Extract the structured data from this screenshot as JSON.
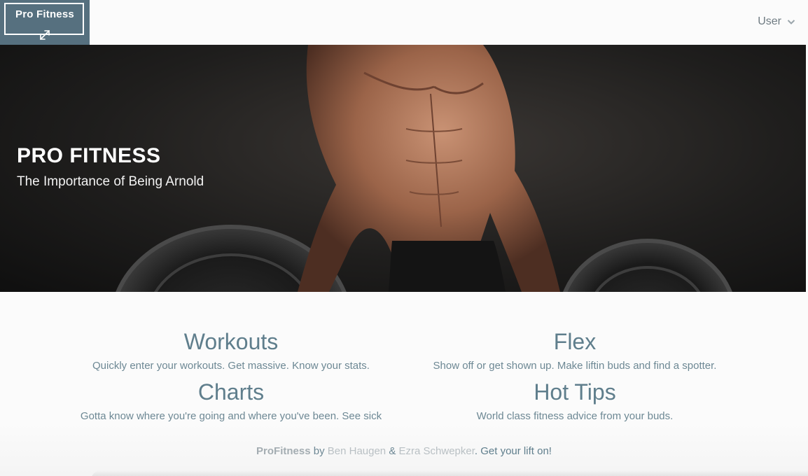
{
  "header": {
    "brand": {
      "text": "Pro Fitness",
      "icon": "expand-arrows-icon"
    },
    "user_menu": {
      "label": "User",
      "icon": "chevron-down-icon"
    }
  },
  "hero": {
    "title": "PRO FITNESS",
    "subtitle": "The Importance of Being Arnold"
  },
  "features": [
    {
      "title": "Workouts",
      "description": "Quickly enter your workouts. Get massive. Know your stats."
    },
    {
      "title": "Flex",
      "description": "Show off or get shown up. Make liftin buds and find a spotter."
    },
    {
      "title": "Charts",
      "description": "Gotta know where you're going and where you've been. See sick"
    },
    {
      "title": "Hot Tips",
      "description": "World class fitness advice from your buds."
    }
  ],
  "footer": {
    "brand": "ProFitness",
    "by": "by",
    "author1": "Ben Haugen",
    "amp": "&",
    "author2": "Ezra Schwepker",
    "tagline": ". Get your lift on!"
  },
  "colors": {
    "brand_bg": "#56707f",
    "accent": "#5f7e8c"
  }
}
